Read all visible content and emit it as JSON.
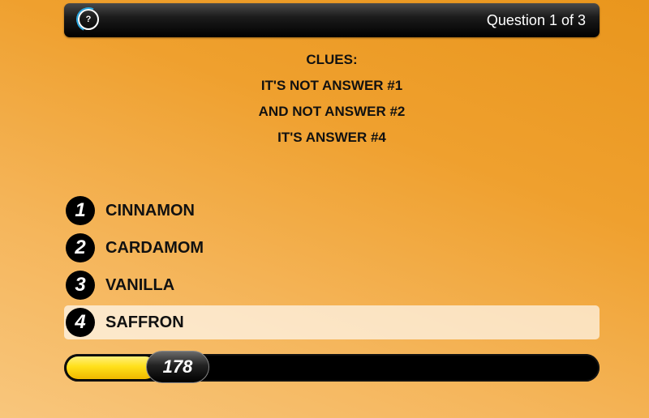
{
  "header": {
    "help_label": "?",
    "question_counter": "Question 1 of 3"
  },
  "clues": {
    "title": "CLUES:",
    "lines": [
      "IT'S NOT ANSWER #1",
      "AND NOT ANSWER #2",
      "IT'S ANSWER #4"
    ]
  },
  "answers": [
    {
      "number": "1",
      "label": "CINNAMON",
      "selected": false
    },
    {
      "number": "2",
      "label": "CARDAMOM",
      "selected": false
    },
    {
      "number": "3",
      "label": "VANILLA",
      "selected": false
    },
    {
      "number": "4",
      "label": "SAFFRON",
      "selected": true
    }
  ],
  "timer": {
    "value": "178",
    "progress_fraction": 0.17
  },
  "colors": {
    "background": "#efa02e",
    "bar_fill": "#ffe01a",
    "selected_row": "#fbe2c0",
    "help_ring": "#2aa7e0"
  }
}
